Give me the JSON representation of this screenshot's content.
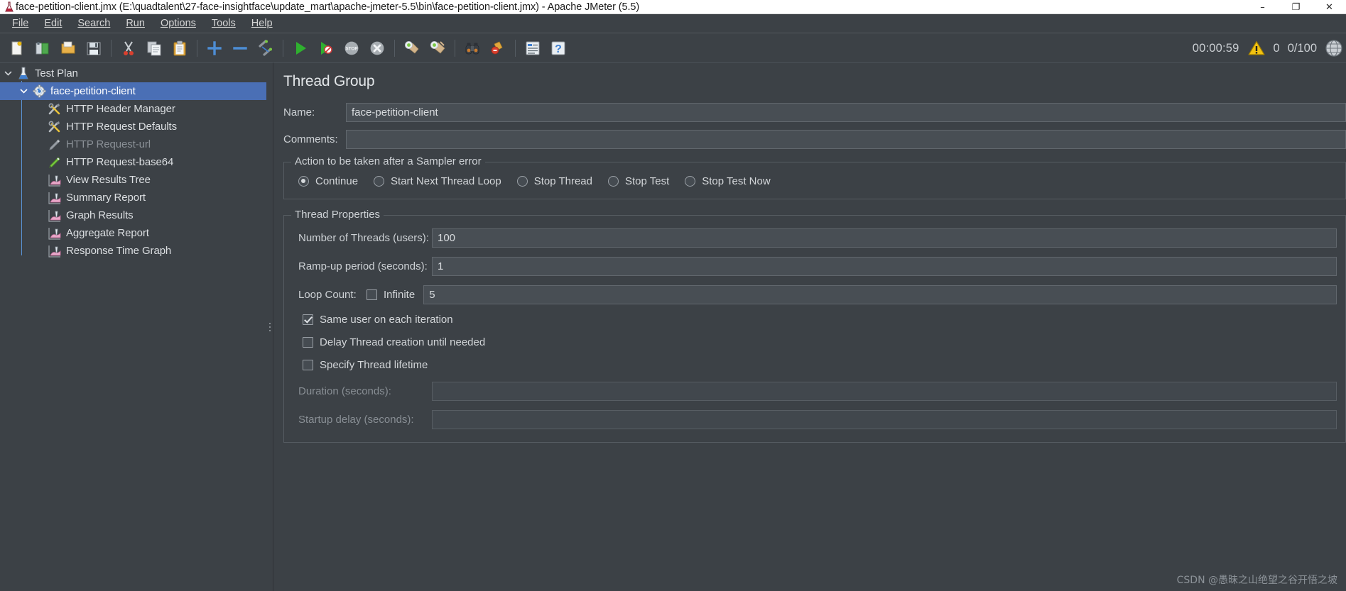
{
  "window": {
    "title": "face-petition-client.jmx (E:\\quadtalent\\27-face-insightface\\update_mart\\apache-jmeter-5.5\\bin\\face-petition-client.jmx) - Apache JMeter (5.5)",
    "minimize": "–",
    "maximize": "❐",
    "close": "✕"
  },
  "menubar": {
    "items": [
      {
        "label": "File",
        "mnemonic": "F"
      },
      {
        "label": "Edit",
        "mnemonic": "E"
      },
      {
        "label": "Search",
        "mnemonic": "S"
      },
      {
        "label": "Run",
        "mnemonic": "R"
      },
      {
        "label": "Options",
        "mnemonic": "O"
      },
      {
        "label": "Tools",
        "mnemonic": "T"
      },
      {
        "label": "Help",
        "mnemonic": "H"
      }
    ]
  },
  "toolbar": {
    "buttons": [
      {
        "icon": "new-file-icon",
        "tooltip": "New"
      },
      {
        "icon": "open-template-icon",
        "tooltip": "Templates"
      },
      {
        "icon": "open-folder-icon",
        "tooltip": "Open"
      },
      {
        "icon": "save-icon",
        "tooltip": "Save"
      },
      {
        "icon": "cut-scissors-icon",
        "tooltip": "Cut"
      },
      {
        "icon": "copy-icon",
        "tooltip": "Copy"
      },
      {
        "icon": "paste-clipboard-icon",
        "tooltip": "Paste"
      },
      {
        "icon": "expand-plus-icon",
        "tooltip": "Expand All"
      },
      {
        "icon": "collapse-minus-icon",
        "tooltip": "Collapse All"
      },
      {
        "icon": "toggle-enable-icon",
        "tooltip": "Toggle"
      },
      {
        "icon": "start-play-icon",
        "tooltip": "Start"
      },
      {
        "icon": "start-no-timers-icon",
        "tooltip": "Start no pauses"
      },
      {
        "icon": "stop-icon",
        "tooltip": "Stop"
      },
      {
        "icon": "shutdown-icon",
        "tooltip": "Shutdown"
      },
      {
        "icon": "clear-icon",
        "tooltip": "Clear"
      },
      {
        "icon": "clear-all-icon",
        "tooltip": "Clear All"
      },
      {
        "icon": "search-binoculars-icon",
        "tooltip": "Search"
      },
      {
        "icon": "search-reset-icon",
        "tooltip": "Reset Search"
      },
      {
        "icon": "function-helper-icon",
        "tooltip": "Function Helper Dialog"
      },
      {
        "icon": "help-icon",
        "tooltip": "Help"
      }
    ],
    "status": {
      "timer": "00:00:59",
      "warning_icon": "warning-triangle-icon",
      "error_count": "0",
      "threads": "0/100",
      "globe_icon": "globe-icon"
    }
  },
  "tree": {
    "items": [
      {
        "label": "Test Plan",
        "icon": "test-plan-icon",
        "indent": 0,
        "expanded": true,
        "selected": false,
        "disabled": false
      },
      {
        "label": "face-petition-client",
        "icon": "thread-group-icon",
        "indent": 1,
        "expanded": true,
        "selected": true,
        "disabled": false
      },
      {
        "label": "HTTP Header Manager",
        "icon": "config-tools-icon",
        "indent": 2,
        "expanded": null,
        "selected": false,
        "disabled": false
      },
      {
        "label": "HTTP Request Defaults",
        "icon": "config-tools-icon",
        "indent": 2,
        "expanded": null,
        "selected": false,
        "disabled": false
      },
      {
        "label": "HTTP Request-url",
        "icon": "sampler-icon-disabled",
        "indent": 2,
        "expanded": null,
        "selected": false,
        "disabled": true
      },
      {
        "label": "HTTP Request-base64",
        "icon": "sampler-icon",
        "indent": 2,
        "expanded": null,
        "selected": false,
        "disabled": false
      },
      {
        "label": "View Results Tree",
        "icon": "listener-icon",
        "indent": 2,
        "expanded": null,
        "selected": false,
        "disabled": false
      },
      {
        "label": "Summary Report",
        "icon": "listener-icon",
        "indent": 2,
        "expanded": null,
        "selected": false,
        "disabled": false
      },
      {
        "label": "Graph Results",
        "icon": "listener-icon",
        "indent": 2,
        "expanded": null,
        "selected": false,
        "disabled": false
      },
      {
        "label": "Aggregate Report",
        "icon": "listener-icon",
        "indent": 2,
        "expanded": null,
        "selected": false,
        "disabled": false
      },
      {
        "label": "Response Time Graph",
        "icon": "listener-icon",
        "indent": 2,
        "expanded": null,
        "selected": false,
        "disabled": false
      }
    ]
  },
  "main": {
    "panel_title": "Thread Group",
    "name_label": "Name:",
    "name_value": "face-petition-client",
    "comments_label": "Comments:",
    "comments_value": "",
    "sampler_error": {
      "legend": "Action to be taken after a Sampler error",
      "options": [
        {
          "label": "Continue",
          "selected": true
        },
        {
          "label": "Start Next Thread Loop",
          "selected": false
        },
        {
          "label": "Stop Thread",
          "selected": false
        },
        {
          "label": "Stop Test",
          "selected": false
        },
        {
          "label": "Stop Test Now",
          "selected": false
        }
      ]
    },
    "thread_properties": {
      "legend": "Thread Properties",
      "num_threads_label": "Number of Threads (users):",
      "num_threads_value": "100",
      "rampup_label": "Ramp-up period (seconds):",
      "rampup_value": "1",
      "loop_count_label": "Loop Count:",
      "infinite_label": "Infinite",
      "infinite_checked": false,
      "loop_count_value": "5",
      "same_user_label": "Same user on each iteration",
      "same_user_checked": true,
      "delay_thread_label": "Delay Thread creation until needed",
      "delay_thread_checked": false,
      "specify_lifetime_label": "Specify Thread lifetime",
      "specify_lifetime_checked": false,
      "duration_label": "Duration (seconds):",
      "duration_value": "",
      "startup_delay_label": "Startup delay (seconds):",
      "startup_delay_value": ""
    }
  },
  "watermark": "CSDN @愚昧之山绝望之谷开悟之坡",
  "colors": {
    "window_bg": "#3c4146",
    "selection_blue": "#4a6fb5",
    "text": "#d3d6d9",
    "disabled_text": "#8a9096",
    "field_bg": "#484e54",
    "warning_yellow": "#f2c211"
  }
}
